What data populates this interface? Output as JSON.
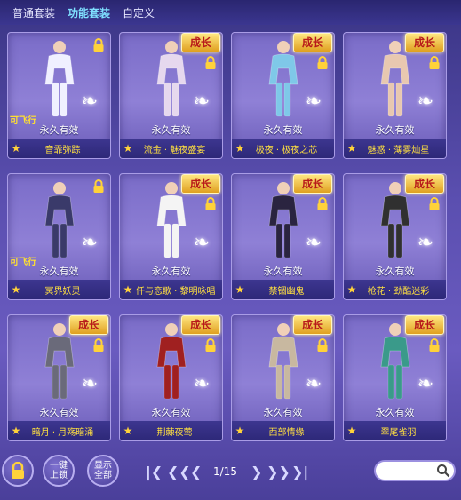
{
  "tabs": [
    {
      "label": "普通套装",
      "active": false
    },
    {
      "label": "功能套装",
      "active": true
    },
    {
      "label": "自定义",
      "active": false
    }
  ],
  "cards": [
    {
      "name": "音霏弥踪",
      "duration": "永久有效",
      "fly": "可飞行",
      "growth": "",
      "color": "#f0f0ff"
    },
    {
      "name": "流金 · 魅夜盛宴",
      "duration": "永久有效",
      "fly": "",
      "growth": "成长",
      "color": "#e6d8ee"
    },
    {
      "name": "极夜 · 极夜之芯",
      "duration": "永久有效",
      "fly": "",
      "growth": "成长",
      "color": "#7fc8e8"
    },
    {
      "name": "魅惑 · 薄雾灿星",
      "duration": "永久有效",
      "fly": "",
      "growth": "成长",
      "color": "#e8c8b0"
    },
    {
      "name": "冥界妖灵",
      "duration": "永久有效",
      "fly": "可飞行",
      "growth": "",
      "color": "#3a3a6a"
    },
    {
      "name": "仟与恋歌 · 黎明咏唱",
      "duration": "永久有效",
      "fly": "",
      "growth": "成长",
      "color": "#f4f4f4"
    },
    {
      "name": "禁锢幽鬼",
      "duration": "永久有效",
      "fly": "",
      "growth": "成长",
      "color": "#2a2440"
    },
    {
      "name": "枪花 · 劲酷迷彩",
      "duration": "永久有效",
      "fly": "",
      "growth": "成长",
      "color": "#303030"
    },
    {
      "name": "暗月 · 月殇暗涌",
      "duration": "永久有效",
      "fly": "",
      "growth": "成长",
      "color": "#6a6a7a"
    },
    {
      "name": "荆棘夜莺",
      "duration": "永久有效",
      "fly": "",
      "growth": "成长",
      "color": "#a02020"
    },
    {
      "name": "西部情缘",
      "duration": "永久有效",
      "fly": "",
      "growth": "成长",
      "color": "#c8b8a0"
    },
    {
      "name": "翠尾雀羽",
      "duration": "永久有效",
      "fly": "",
      "growth": "成长",
      "color": "#3a9a8a"
    }
  ],
  "bottom": {
    "lock_icon": "lock-icon",
    "lock_all_label_1": "一键",
    "lock_all_label_2": "上锁",
    "show_all_label_1": "显示",
    "show_all_label_2": "全部",
    "page": "1/15",
    "search_placeholder": ""
  }
}
